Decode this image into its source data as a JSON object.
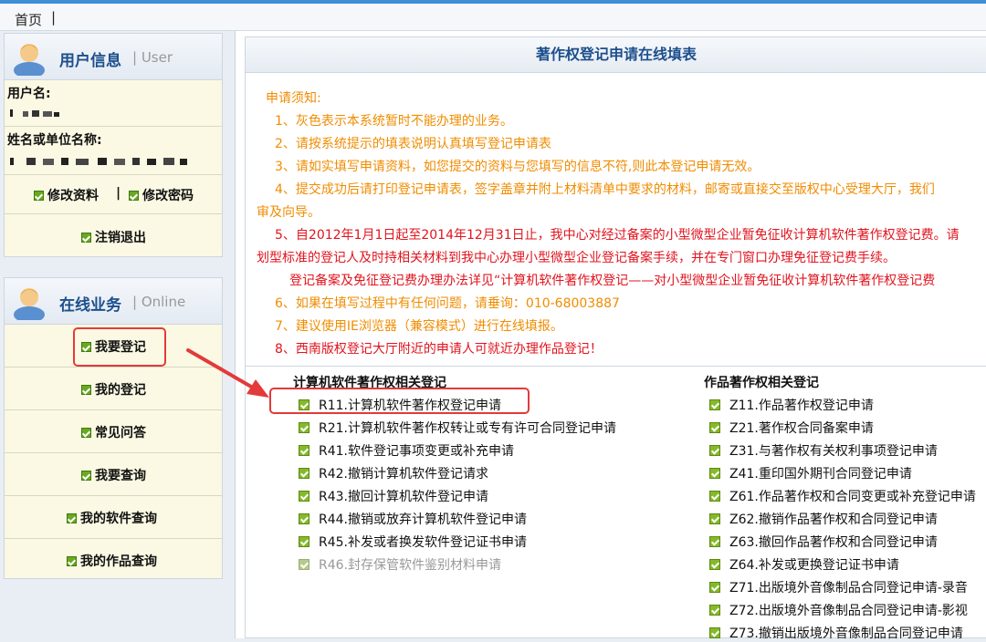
{
  "topbar": {
    "home": "首页",
    "sep": "|"
  },
  "user_panel": {
    "title": "用户信息",
    "subtitle": "| User",
    "username_label": "用户名:",
    "name_label": "姓名或单位名称:",
    "edit_profile": "修改资料",
    "sep": "|",
    "change_password": "修改密码",
    "logout": "注销退出"
  },
  "online_panel": {
    "title": "在线业务",
    "subtitle": "| Online",
    "items": [
      "我要登记",
      "我的登记",
      "常见问答",
      "我要查询",
      "我的软件查询",
      "我的作品查询"
    ]
  },
  "main": {
    "title": "著作权登记申请在线填表",
    "notice_title": "申请须知:",
    "notices": [
      "1、灰色表示本系统暂时不能办理的业务。",
      "2、请按系统提示的填表说明认真填写登记申请表",
      "3、请如实填写申请资料，如您提交的资料与您填写的信息不符,则此本登记申请无效。",
      "4、提交成功后请打印登记申请表，签字盖章并附上材料清单中要求的材料，邮寄或直接交至版权中心受理大厅，我们",
      "审及向导。",
      "5、自2012年1月1日起至2014年12月31日止，我中心对经过备案的小型微型企业暂免征收计算机软件著作权登记费。请",
      "划型标准的登记人及时持相关材料到我中心办理小型微型企业登记备案手续，并在专门窗口办理免征登记费手续。",
      "登记备案及免征登记费办理办法详见“计算机软件著作权登记——对小型微型企业暂免征收计算机软件著作权登记费",
      "6、如果在填写过程中有任何问题，请垂询：010-68003887",
      "7、建议使用IE浏览器（兼容模式）进行在线填报。",
      "8、西南版权登记大厅附近的申请人可就近办理作品登记！"
    ],
    "software_title": "计算机软件著作权相关登记",
    "software_items": [
      "R11.计算机软件著作权登记申请",
      "R21.计算机软件著作权转让或专有许可合同登记申请",
      "R41.软件登记事项变更或补充申请",
      "R42.撤销计算机软件登记请求",
      "R43.撤回计算机软件登记申请",
      "R44.撤销或放弃计算机软件登记申请",
      "R45.补发或者换发软件登记证书申请",
      "R46.封存保管软件鉴别材料申请"
    ],
    "works_title": "作品著作权相关登记",
    "works_items": [
      "Z11.作品著作权登记申请",
      "Z21.著作权合同备案申请",
      "Z31.与著作权有关权利事项登记申请",
      "Z41.重印国外期刊合同登记申请",
      "Z61.作品著作权和合同变更或补充登记申请",
      "Z62.撤销作品著作权和合同登记申请",
      "Z63.撤回作品著作权和合同登记申请",
      "Z64.补发或更换登记证书申请",
      "Z71.出版境外音像制品合同登记申请-录音",
      "Z72.出版境外音像制品合同登记申请-影视",
      "Z73.撤销出版境外音像制品合同登记申请"
    ]
  },
  "colors": {
    "accent": "#3f8fd6",
    "title_blue": "#1d4f8c",
    "notice_orange": "#f08c00",
    "notice_red": "#e0141e",
    "highlight": "#e33a3a"
  }
}
